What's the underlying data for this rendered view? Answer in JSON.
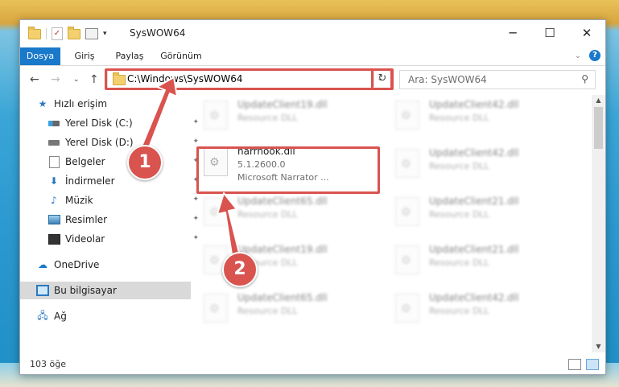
{
  "window": {
    "title": "SysWOW64"
  },
  "ribbon": {
    "tabs": [
      "Dosya",
      "Giriş",
      "Paylaş",
      "Görünüm"
    ]
  },
  "address": {
    "path": "C:\\Windows\\SysWOW64"
  },
  "search": {
    "placeholder": "Ara: SysWOW64"
  },
  "nav_pane": {
    "items": [
      {
        "label": "Hızlı erişim",
        "icon": "star-icon"
      },
      {
        "label": "Yerel Disk (C:)",
        "icon": "drive-icon"
      },
      {
        "label": "Yerel Disk (D:)",
        "icon": "drive-icon"
      },
      {
        "label": "Belgeler",
        "icon": "document-icon"
      },
      {
        "label": "İndirmeler",
        "icon": "download-icon"
      },
      {
        "label": "Müzik",
        "icon": "music-icon"
      },
      {
        "label": "Resimler",
        "icon": "picture-icon"
      },
      {
        "label": "Videolar",
        "icon": "video-icon"
      },
      {
        "label": "OneDrive",
        "icon": "cloud-icon"
      },
      {
        "label": "Bu bilgisayar",
        "icon": "computer-icon"
      },
      {
        "label": "Ağ",
        "icon": "network-icon"
      }
    ]
  },
  "files": {
    "highlighted": {
      "name": "narrhook.dll",
      "version": "5.1.2600.0",
      "description": "Microsoft Narrator ..."
    },
    "col1": [
      {
        "name": "UpdateClient19.dll",
        "sub": "Resource DLL"
      },
      {
        "name": "UpdateClient65.dll",
        "sub": "Resource DLL"
      },
      {
        "name": "UpdateClient19.dll",
        "sub": "Resource DLL"
      },
      {
        "name": "UpdateClient65.dll",
        "sub": "Resource DLL"
      }
    ],
    "col2": [
      {
        "name": "UpdateClient42.dll",
        "sub": "Resource DLL"
      },
      {
        "name": "UpdateClient42.dll",
        "sub": "Resource DLL"
      },
      {
        "name": "UpdateClient21.dll",
        "sub": "Resource DLL"
      },
      {
        "name": "UpdateClient21.dll",
        "sub": "Resource DLL"
      },
      {
        "name": "UpdateClient42.dll",
        "sub": "Resource DLL"
      }
    ]
  },
  "status": {
    "count": "103 öğe"
  },
  "annotations": {
    "step1": "1",
    "step2": "2"
  },
  "colors": {
    "accent": "#1979ca",
    "highlight": "#d9534f"
  }
}
